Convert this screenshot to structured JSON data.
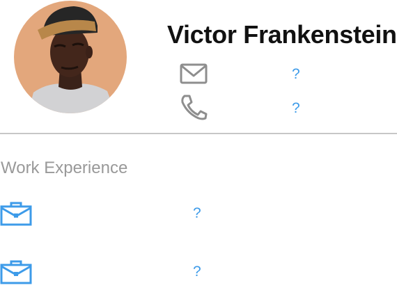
{
  "profile": {
    "name": "Victor Frankenstein",
    "avatar_icon": "person-photo",
    "email_icon": "envelope-icon",
    "email_value": "?",
    "phone_icon": "phone-icon",
    "phone_value": "?"
  },
  "work": {
    "section_title": "Work Experience",
    "items": [
      {
        "icon": "briefcase-icon",
        "value": "?"
      },
      {
        "icon": "briefcase-icon",
        "value": "?"
      }
    ]
  },
  "colors": {
    "accent": "#3d9be9",
    "icon_gray": "#8e8e8e",
    "divider": "#c7c7c7",
    "avatar_bg": "#e3a77c"
  }
}
